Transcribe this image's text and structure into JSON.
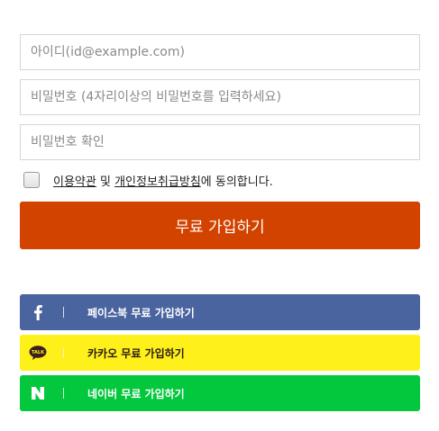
{
  "form": {
    "id_placeholder": "아이디(id@example.com)",
    "password_placeholder": "비밀번호 (4자리이상의 비밀번호를 입력하세요)",
    "password_confirm_placeholder": "비밀번호 확인",
    "agree": {
      "checked": false,
      "terms_link": "이용약관",
      "and": "및",
      "privacy_link": "개인정보취급방침",
      "suffix": "에 동의합니다."
    },
    "submit_label": "무료 가입하기"
  },
  "social": [
    {
      "name": "facebook",
      "label": "페이스북 무료 가입하기",
      "icon": "facebook-f-icon",
      "color": "#4a64a0"
    },
    {
      "name": "kakao",
      "label": "카카오 무료 가입하기",
      "icon": "kakao-talk-icon",
      "color": "#fef01b"
    },
    {
      "name": "naver",
      "label": "네이버 무료 가입하기",
      "icon": "naver-n-icon",
      "color": "#03c73c"
    }
  ],
  "colors": {
    "submit": "#d34300"
  }
}
